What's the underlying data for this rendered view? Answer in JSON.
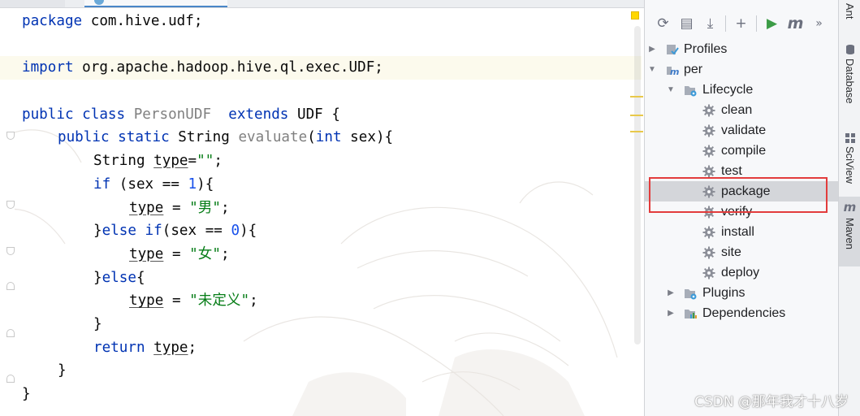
{
  "editor": {
    "lines": [
      {
        "tokens": [
          {
            "t": "package ",
            "c": "kw"
          },
          {
            "t": "com.hive.udf;",
            "c": ""
          }
        ]
      },
      {
        "tokens": []
      },
      {
        "tokens": [
          {
            "t": "import ",
            "c": "kw"
          },
          {
            "t": "org.apache.hadoop.hive.ql.exec.UDF;",
            "c": ""
          }
        ]
      },
      {
        "tokens": []
      },
      {
        "tokens": [
          {
            "t": "public class ",
            "c": "kw"
          },
          {
            "t": "PersonUDF",
            "c": "cls"
          },
          {
            "t": "  ",
            "c": ""
          },
          {
            "t": "extends ",
            "c": "kw"
          },
          {
            "t": "UDF {",
            "c": ""
          }
        ]
      },
      {
        "tokens": [
          {
            "t": "public static ",
            "c": "kw"
          },
          {
            "t": "String ",
            "c": ""
          },
          {
            "t": "evaluate",
            "c": "fn"
          },
          {
            "t": "(",
            "c": ""
          },
          {
            "t": "int ",
            "c": "kw"
          },
          {
            "t": "sex){",
            "c": ""
          }
        ]
      },
      {
        "tokens": [
          {
            "t": "String ",
            "c": ""
          },
          {
            "t": "type",
            "c": "var"
          },
          {
            "t": "=",
            "c": ""
          },
          {
            "t": "\"\"",
            "c": "str"
          },
          {
            "t": ";",
            "c": ""
          }
        ]
      },
      {
        "tokens": [
          {
            "t": "if ",
            "c": "kw"
          },
          {
            "t": "(sex == ",
            "c": ""
          },
          {
            "t": "1",
            "c": "num"
          },
          {
            "t": "){",
            "c": ""
          }
        ]
      },
      {
        "tokens": [
          {
            "t": "type",
            "c": "var"
          },
          {
            "t": " = ",
            "c": ""
          },
          {
            "t": "\"男\"",
            "c": "str"
          },
          {
            "t": ";",
            "c": ""
          }
        ]
      },
      {
        "tokens": [
          {
            "t": "}",
            "c": ""
          },
          {
            "t": "else if",
            "c": "kw"
          },
          {
            "t": "(sex == ",
            "c": ""
          },
          {
            "t": "0",
            "c": "num"
          },
          {
            "t": "){",
            "c": ""
          }
        ]
      },
      {
        "tokens": [
          {
            "t": "type",
            "c": "var"
          },
          {
            "t": " = ",
            "c": ""
          },
          {
            "t": "\"女\"",
            "c": "str"
          },
          {
            "t": ";",
            "c": ""
          }
        ]
      },
      {
        "tokens": [
          {
            "t": "}",
            "c": ""
          },
          {
            "t": "else",
            "c": "kw"
          },
          {
            "t": "{",
            "c": ""
          }
        ]
      },
      {
        "tokens": [
          {
            "t": "type",
            "c": "var"
          },
          {
            "t": " = ",
            "c": ""
          },
          {
            "t": "\"未定义\"",
            "c": "str"
          },
          {
            "t": ";",
            "c": ""
          }
        ]
      },
      {
        "tokens": [
          {
            "t": "}",
            "c": ""
          }
        ]
      },
      {
        "tokens": [
          {
            "t": "return ",
            "c": "kw"
          },
          {
            "t": "type",
            "c": "var"
          },
          {
            "t": ";",
            "c": ""
          }
        ]
      },
      {
        "tokens": [
          {
            "t": "}",
            "c": ""
          }
        ]
      },
      {
        "tokens": [
          {
            "t": "}",
            "c": ""
          }
        ]
      }
    ]
  },
  "maven": {
    "toolbar": [
      {
        "name": "reload-icon",
        "glyph": "⟳"
      },
      {
        "name": "generate-sources-icon",
        "glyph": "▤"
      },
      {
        "name": "download-icon",
        "glyph": "⤓"
      },
      {
        "name": "add-icon",
        "glyph": "+"
      },
      {
        "name": "run-icon",
        "glyph": "▶"
      },
      {
        "name": "execute-goal-icon",
        "glyph": "m"
      },
      {
        "name": "more-icon",
        "glyph": "»"
      }
    ],
    "tree": {
      "profiles": "Profiles",
      "project": "per",
      "lifecycle": "Lifecycle",
      "phases": [
        "clean",
        "validate",
        "compile",
        "test",
        "package",
        "verify",
        "install",
        "site",
        "deploy"
      ],
      "selected_phase": "package",
      "plugins": "Plugins",
      "dependencies": "Dependencies"
    }
  },
  "side_tabs": {
    "ant": "Ant",
    "database": "Database",
    "sciview": "SciView",
    "maven": "Maven"
  },
  "watermark": "CSDN @那年我才十八岁",
  "colors": {
    "keyword": "#0033b3",
    "string": "#067d17",
    "number": "#1750eb",
    "selection_box": "#e23c3c",
    "run_icon": "#3c9c46"
  }
}
